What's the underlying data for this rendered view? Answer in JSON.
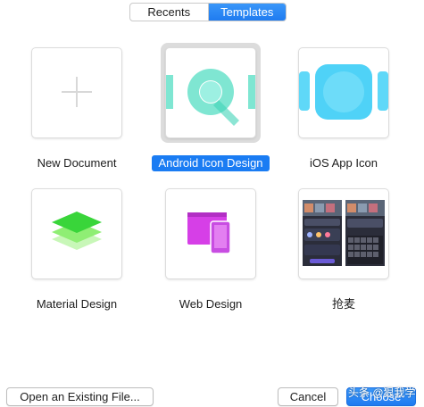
{
  "tabs": {
    "recents": "Recents",
    "templates": "Templates",
    "active": "templates"
  },
  "templates": [
    {
      "label": "New Document",
      "icon": "plus-icon"
    },
    {
      "label": "Android Icon Design",
      "icon": "android-icon-template-icon",
      "selected": true
    },
    {
      "label": "iOS App Icon",
      "icon": "ios-icon-template-icon"
    },
    {
      "label": "Material Design",
      "icon": "material-layers-icon"
    },
    {
      "label": "Web Design",
      "icon": "web-design-icon"
    },
    {
      "label": "抢麦",
      "icon": "app-screens-thumbnail"
    }
  ],
  "footer": {
    "open_existing": "Open an Existing File...",
    "cancel": "Cancel",
    "choose": "Choose"
  },
  "watermark": "头条 @狠我学",
  "colors": {
    "accent": "#1a7cf3",
    "android_teal": "#7fe6d2",
    "android_teal_dark": "#3fd4b8",
    "ios_blue": "#4fd2f7",
    "material_green": "#39d53a",
    "web_magenta": "#d63fe7"
  }
}
